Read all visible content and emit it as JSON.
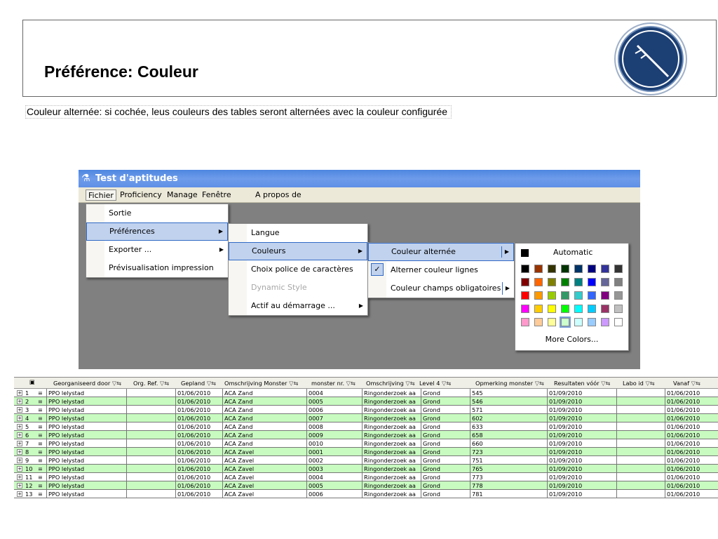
{
  "slide": {
    "title": "Préférence: Couleur",
    "description": "Couleur alternée: si cochée, leus couleurs des tables seront alternées avec la couleur configurée"
  },
  "app": {
    "window_title": "Test d'aptitudes",
    "menubar": [
      "Fichier",
      "Proficiency",
      "Manage",
      "Fenêtre",
      "A propos de"
    ],
    "file_menu": [
      "Sortie",
      "Préférences",
      "Exporter ...",
      "Prévisualisation impression"
    ],
    "prefs_menu": [
      "Langue",
      "Couleurs",
      "Choix police de caractères",
      "Dynamic Style",
      "Actif au démarrage ..."
    ],
    "colors_menu": [
      "Couleur alternée",
      "Alterner couleur lignes",
      "Couleur champs obligatoires"
    ],
    "palette": {
      "automatic_label": "Automatic",
      "more_label": "More Colors...",
      "colors": [
        [
          "#000000",
          "#993300",
          "#333300",
          "#003300",
          "#003366",
          "#000080",
          "#333399",
          "#333333"
        ],
        [
          "#800000",
          "#FF6600",
          "#808000",
          "#008000",
          "#008080",
          "#0000FF",
          "#666699",
          "#808080"
        ],
        [
          "#FF0000",
          "#FF9900",
          "#99CC00",
          "#339966",
          "#33CCCC",
          "#3366FF",
          "#800080",
          "#969696"
        ],
        [
          "#FF00FF",
          "#FFCC00",
          "#FFFF00",
          "#00FF00",
          "#00FFFF",
          "#00CCFF",
          "#993366",
          "#C0C0C0"
        ],
        [
          "#FF99CC",
          "#FFCC99",
          "#FFFF99",
          "#CCFFCC",
          "#CCFFFF",
          "#99CCFF",
          "#CC99FF",
          "#FFFFFF"
        ]
      ],
      "selected": "#CCFFCC"
    }
  },
  "grid": {
    "headers": [
      "Georganiseerd door",
      "Org. Ref.",
      "Gepland",
      "Omschrijving Monster",
      "monster nr.",
      "Omschrijving",
      "Level 4",
      "Opmerking monster",
      "Resultaten vóór",
      "Labo id",
      "Vanaf"
    ],
    "alt_color": "#C8FBC0",
    "rows": [
      [
        "1",
        "PPO lelystad",
        "",
        "01/06/2010",
        "ACA Zand",
        "0004",
        "Ringonderzoek aa",
        "Grond",
        "545",
        "01/09/2010",
        "",
        "01/06/2010"
      ],
      [
        "2",
        "PPO lelystad",
        "",
        "01/06/2010",
        "ACA Zand",
        "0005",
        "Ringonderzoek aa",
        "Grond",
        "546",
        "01/09/2010",
        "",
        "01/06/2010"
      ],
      [
        "3",
        "PPO lelystad",
        "",
        "01/06/2010",
        "ACA Zand",
        "0006",
        "Ringonderzoek aa",
        "Grond",
        "571",
        "01/09/2010",
        "",
        "01/06/2010"
      ],
      [
        "4",
        "PPO lelystad",
        "",
        "01/06/2010",
        "ACA Zand",
        "0007",
        "Ringonderzoek aa",
        "Grond",
        "602",
        "01/09/2010",
        "",
        "01/06/2010"
      ],
      [
        "5",
        "PPO lelystad",
        "",
        "01/06/2010",
        "ACA Zand",
        "0008",
        "Ringonderzoek aa",
        "Grond",
        "633",
        "01/09/2010",
        "",
        "01/06/2010"
      ],
      [
        "6",
        "PPO lelystad",
        "",
        "01/06/2010",
        "ACA Zand",
        "0009",
        "Ringonderzoek aa",
        "Grond",
        "658",
        "01/09/2010",
        "",
        "01/06/2010"
      ],
      [
        "7",
        "PPO lelystad",
        "",
        "01/06/2010",
        "ACA Zand",
        "0010",
        "Ringonderzoek aa",
        "Grond",
        "660",
        "01/09/2010",
        "",
        "01/06/2010"
      ],
      [
        "8",
        "PPO lelystad",
        "",
        "01/06/2010",
        "ACA Zavel",
        "0001",
        "Ringonderzoek aa",
        "Grond",
        "723",
        "01/09/2010",
        "",
        "01/06/2010"
      ],
      [
        "9",
        "PPO lelystad",
        "",
        "01/06/2010",
        "ACA Zavel",
        "0002",
        "Ringonderzoek aa",
        "Grond",
        "751",
        "01/09/2010",
        "",
        "01/06/2010"
      ],
      [
        "10",
        "PPO lelystad",
        "",
        "01/06/2010",
        "ACA Zavel",
        "0003",
        "Ringonderzoek aa",
        "Grond",
        "765",
        "01/09/2010",
        "",
        "01/06/2010"
      ],
      [
        "11",
        "PPO lelystad",
        "",
        "01/06/2010",
        "ACA Zavel",
        "0004",
        "Ringonderzoek aa",
        "Grond",
        "773",
        "01/09/2010",
        "",
        "01/06/2010"
      ],
      [
        "12",
        "PPO lelystad",
        "",
        "01/06/2010",
        "ACA Zavel",
        "0005",
        "Ringonderzoek aa",
        "Grond",
        "778",
        "01/09/2010",
        "",
        "01/06/2010"
      ],
      [
        "13",
        "PPO lelystad",
        "",
        "01/06/2010",
        "ACA Zavel",
        "0006",
        "Ringonderzoek aa",
        "Grond",
        "781",
        "01/09/2010",
        "",
        "01/06/2010"
      ]
    ]
  }
}
